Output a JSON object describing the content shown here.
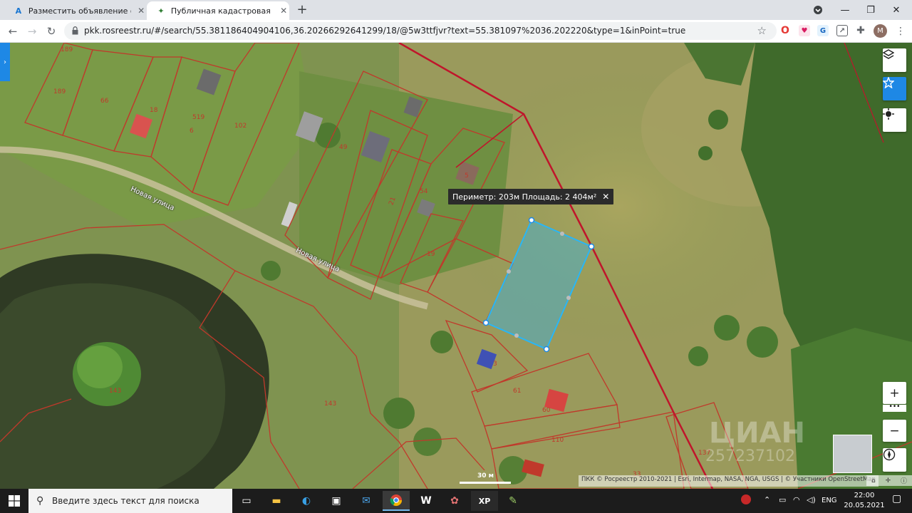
{
  "tabs": [
    {
      "title": "Разместить объявление о прод",
      "favicon": "A"
    },
    {
      "title": "Публичная кадастровая карта",
      "favicon": "✦"
    }
  ],
  "toolbar": {
    "url": "pkk.rosreestr.ru/#/search/55.381186404904106,36.20266292641299/18/@5w3ttfjvr?text=55.381097%2036.202220&type=1&inPoint=true",
    "profile_initial": "M"
  },
  "map": {
    "measure": "Периметр: 203м Площадь: 2 404м²",
    "scale": "30 м",
    "attribution": "ПКК © Росреестр 2010-2021 | Esri, Intermap, NASA, NGA, USGS | © Участники OpenStreetMap",
    "watermark": "ЦИАН",
    "watermark_id": "257237102",
    "streets": [
      "Новая улица",
      "Новая улица"
    ],
    "parcels": [
      "189",
      "189",
      "66",
      "18",
      "519",
      "6",
      "102",
      "49",
      "21",
      "54",
      "5",
      "19",
      "3",
      "61",
      "60",
      "110",
      "137",
      "33",
      "143",
      "143",
      "3"
    ]
  },
  "taskbar": {
    "search_placeholder": "Введите здесь текст для поиска",
    "lang": "ENG",
    "time": "22:00",
    "date": "20.05.2021"
  },
  "colors": {
    "parcel_border": "#c0392b",
    "measure_polygon": "#29b6f6",
    "accent": "#1e88e5"
  }
}
